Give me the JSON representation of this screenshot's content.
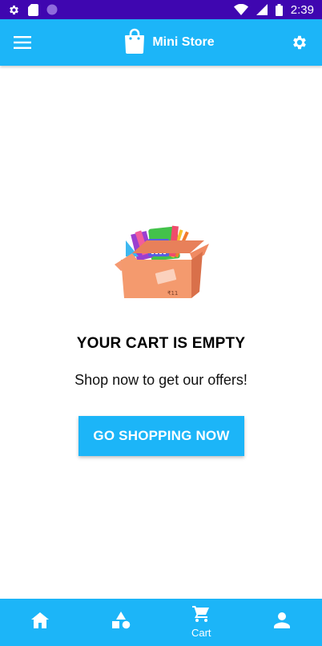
{
  "status_bar": {
    "time": "2:39",
    "left_icons": [
      "gear-icon",
      "sd-card-icon",
      "circle-dot-icon"
    ],
    "right_icons": [
      "wifi-icon",
      "cellular-signal-icon",
      "battery-icon"
    ]
  },
  "app_bar": {
    "title": "Mini Store",
    "menu_icon": "hamburger-menu-icon",
    "logo_icon": "shopping-bag-icon",
    "settings_icon": "gear-icon"
  },
  "empty_state": {
    "illustration": "box-of-supplies-icon",
    "title": "YOUR CART IS EMPTY",
    "subtitle": "Shop now to get our offers!",
    "cta_label": "GO SHOPPING NOW"
  },
  "bottom_nav": {
    "items": [
      {
        "icon": "home-icon",
        "label": ""
      },
      {
        "icon": "categories-icon",
        "label": ""
      },
      {
        "icon": "cart-icon",
        "label": "Cart",
        "active": true
      },
      {
        "icon": "person-icon",
        "label": ""
      }
    ]
  },
  "colors": {
    "primary": "#1cb5f8",
    "status_bar": "#3f06b0",
    "background": "#ffffff"
  }
}
